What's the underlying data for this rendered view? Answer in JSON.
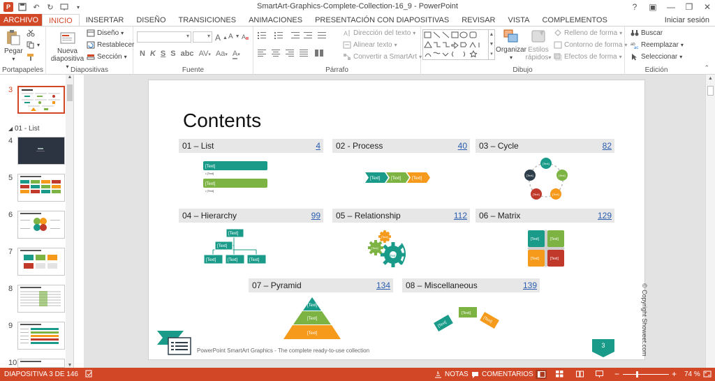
{
  "window": {
    "title": "SmartArt-Graphics-Complete-Collection-16_9 - PowerPoint",
    "controls": [
      "?",
      "▣",
      "—",
      "❐",
      "✕"
    ]
  },
  "quick_access": {
    "logo": "P"
  },
  "ribbon_tabs": {
    "file": "ARCHIVO",
    "items": [
      "INICIO",
      "INSERTAR",
      "DISEÑO",
      "TRANSICIONES",
      "ANIMACIONES",
      "PRESENTACIÓN CON DIAPOSITIVAS",
      "REVISAR",
      "VISTA",
      "COMPLEMENTOS"
    ],
    "active": "INICIO",
    "signin": "Iniciar sesión"
  },
  "ribbon": {
    "clipboard": {
      "paste": "Pegar",
      "label": "Portapapeles"
    },
    "slides": {
      "new_slide_line1": "Nueva",
      "new_slide_line2": "diapositiva",
      "layout": "Diseño",
      "reset": "Restablecer",
      "section": "Sección",
      "label": "Diapositivas"
    },
    "font": {
      "bold": "N",
      "italic": "K",
      "underline": "S",
      "strike": "S",
      "spacing": "AV",
      "case": "Aa",
      "grow": "A",
      "shrink": "A",
      "color": "A",
      "label": "Fuente"
    },
    "paragraph": {
      "text_direction": "Dirección del texto",
      "align_text": "Alinear texto",
      "smartart": "Convertir a SmartArt",
      "label": "Párrafo"
    },
    "drawing": {
      "arrange": "Organizar",
      "quick_styles_line1": "Estilos",
      "quick_styles_line2": "rápidos",
      "shape_fill": "Relleno de forma",
      "shape_outline": "Contorno de forma",
      "shape_effects": "Efectos de forma",
      "label": "Dibujo"
    },
    "editing": {
      "find": "Buscar",
      "replace": "Reemplazar",
      "select": "Seleccionar",
      "label": "Edición"
    }
  },
  "thumbnails": {
    "section": "01 - List",
    "numbers": [
      "3",
      "4",
      "5",
      "6",
      "7",
      "8",
      "9",
      "10"
    ],
    "selected": "3"
  },
  "slide": {
    "title": "Contents",
    "sections": [
      {
        "label": "01 – List",
        "page": "4"
      },
      {
        "label": "02 - Process",
        "page": "40"
      },
      {
        "label": "03 – Cycle",
        "page": "82"
      },
      {
        "label": "04 – Hierarchy",
        "page": "99"
      },
      {
        "label": "05 – Relationship",
        "page": "112"
      },
      {
        "label": "06 – Matrix",
        "page": "129"
      },
      {
        "label": "07 – Pyramid",
        "page": "134"
      },
      {
        "label": "08 – Miscellaneous",
        "page": "139"
      }
    ],
    "placeholder": "[Text]",
    "bullet": "• [Text]",
    "footer": "PowerPoint SmartArt Graphics - The complete ready-to-use collection",
    "page_number": "3",
    "copyright": "© Copyright Showeet.com"
  },
  "statusbar": {
    "slide_info": "DIAPOSITIVA 3 DE 146",
    "notes": "NOTAS",
    "comments": "COMENTARIOS",
    "zoom": "74 %"
  },
  "colors": {
    "accent": "#d24726",
    "green": "#7cb342",
    "teal": "#1a9b8a",
    "orange": "#f59a1b",
    "red": "#c0392b",
    "link": "#2a5db0"
  }
}
